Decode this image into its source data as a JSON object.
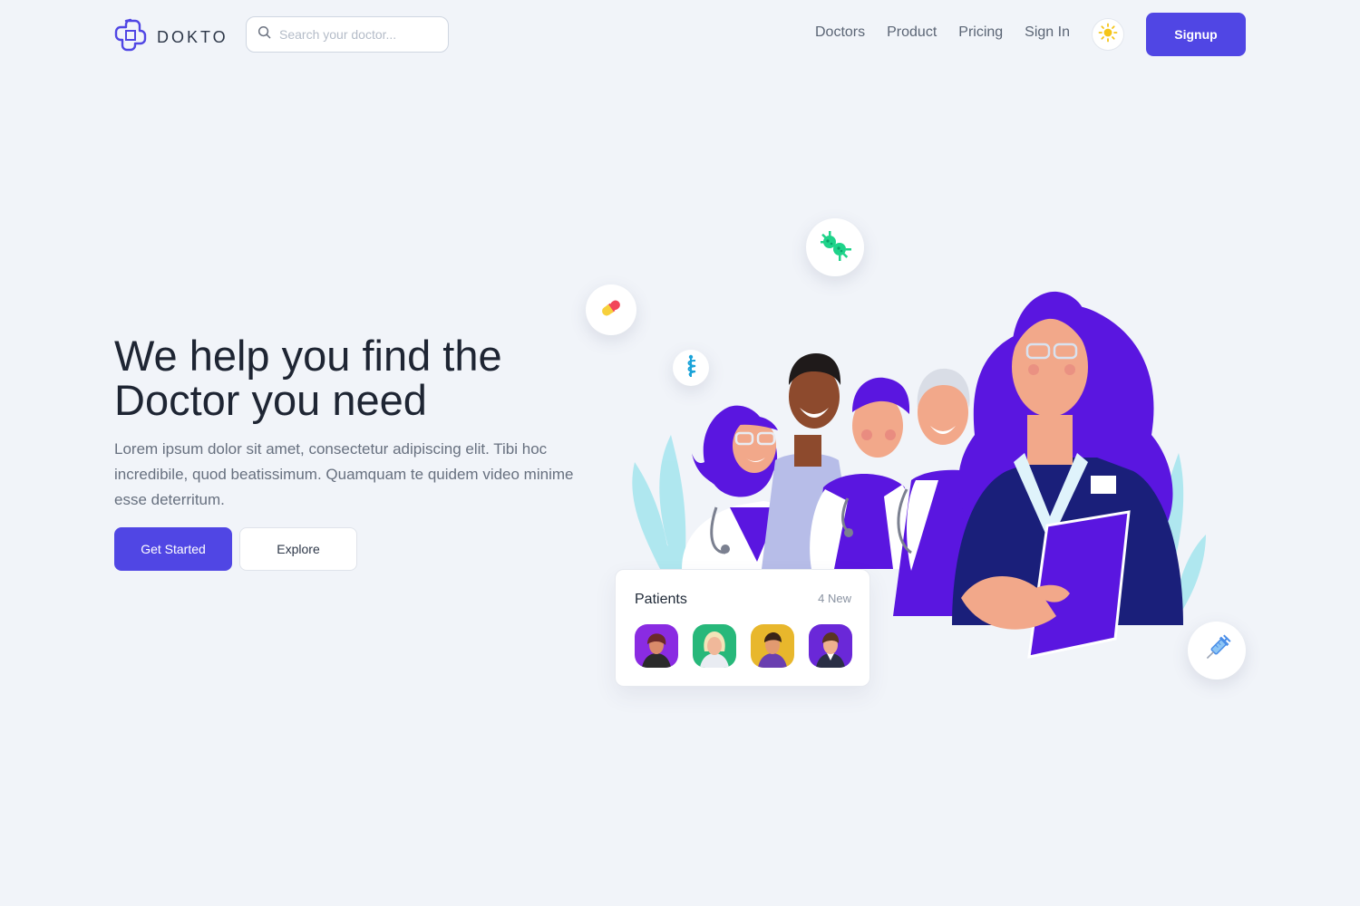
{
  "header": {
    "logo_text": "DOKTO",
    "search_placeholder": "Search your doctor...",
    "nav": [
      "Doctors",
      "Product",
      "Pricing",
      "Sign In"
    ],
    "signup_label": "Signup"
  },
  "hero": {
    "title_line1": "We help you find the",
    "title_line2": "Doctor you need",
    "description": "Lorem ipsum dolor sit amet, consectetur adipiscing elit. Tibi hoc incredibile, quod beatissimum. Quamquam te quidem video minime esse deterritum.",
    "primary_label": "Get Started",
    "secondary_label": "Explore"
  },
  "patients_card": {
    "title": "Patients",
    "badge": "4 New"
  },
  "icons": {
    "logo": "medical-cross-logo-icon",
    "search": "search-icon",
    "theme": "sun-icon",
    "floating": [
      "pill-icon",
      "virus-icon",
      "caduceus-icon",
      "syringe-icon"
    ]
  },
  "colors": {
    "accent": "#5046e4",
    "background": "#f1f4f9",
    "doctor_purple": "#5a16e0",
    "doctor_navy": "#1a1f7a"
  }
}
